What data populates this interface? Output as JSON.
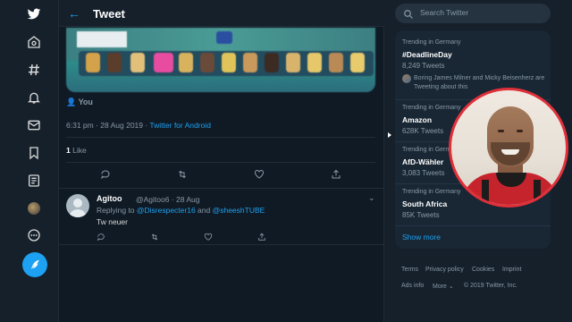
{
  "header": {
    "title": "Tweet",
    "back_icon": "arrow-left-icon"
  },
  "nav": {
    "items": [
      "twitter-logo-icon",
      "home-icon",
      "explore-hashtag-icon",
      "notifications-bell-icon",
      "messages-envelope-icon",
      "bookmarks-icon",
      "lists-icon",
      "profile-avatar-icon",
      "more-circle-icon"
    ],
    "tweet_button_icon": "compose-feather-icon"
  },
  "tweet": {
    "you_label": "You",
    "timestamp": "6:31 pm · 28 Aug 2019 · ",
    "source": "Twitter for Android",
    "like_count": "1",
    "like_label": "Like"
  },
  "reply": {
    "name": "Agitoo",
    "handle": "@Agitoo6 · 28 Aug",
    "replying_prefix": "Replying to ",
    "mention1": "@Disrespecter16",
    "and": " and ",
    "mention2": "@sheeshTUBE",
    "text": "Tw neuer"
  },
  "search": {
    "placeholder": "Search Twitter"
  },
  "trends": [
    {
      "context": "Trending in Germany",
      "name": "#DeadlineDay",
      "count": "8,249 Tweets",
      "desc": "Boring James Milner and Micky Beisenherz are Tweeting about this"
    },
    {
      "context": "Trending in Germany",
      "name": "Amazon",
      "count": "628K Tweets"
    },
    {
      "context": "Trending in Germany",
      "name": "AfD-Wähler",
      "count": "3,083 Tweets"
    },
    {
      "context": "Trending in Germany",
      "name": "South Africa",
      "count": "85K Tweets"
    }
  ],
  "show_more": "Show more",
  "footer": {
    "terms": "Terms",
    "privacy": "Privacy policy",
    "cookies": "Cookies",
    "imprint": "Imprint",
    "ads": "Ads info",
    "more": "More ⌄",
    "copyright": "© 2019 Twitter, Inc."
  },
  "colors": {
    "background": "#15202b",
    "accent": "#1da1f2",
    "webcam_ring": "#e0303a"
  }
}
